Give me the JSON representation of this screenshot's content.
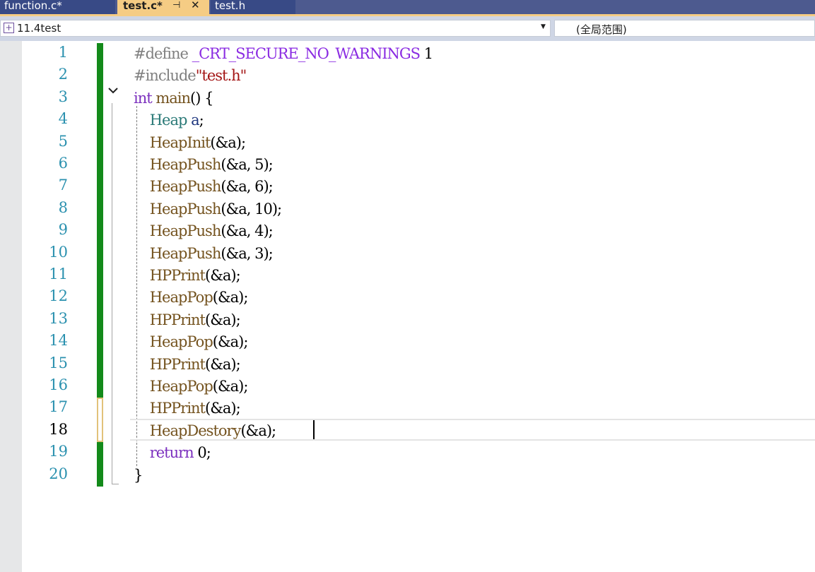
{
  "tabs": [
    {
      "id": "function",
      "label": "function.c*",
      "active": false
    },
    {
      "id": "test_c",
      "label": "test.c*",
      "active": true,
      "pin_icon": "pin-icon",
      "close_icon": "close-icon",
      "close_glyph": "✕",
      "pin_glyph": "⊣"
    },
    {
      "id": "test_h",
      "label": "test.h",
      "active": false
    }
  ],
  "navbar": {
    "project": "11.4test",
    "project_icon": "project-icon",
    "scope": "(全局范围)",
    "dropdown_icon": "chevron-down-icon"
  },
  "editor": {
    "current_line": 18,
    "colors": {
      "keyword": "#7b2fbe",
      "macro": "#8a2be2",
      "string": "#a31515",
      "function": "#74531f",
      "type": "#2b7a78",
      "variable": "#1f377f",
      "number": "#000000",
      "plain": "#000000",
      "preprocessor": "#808080",
      "line_number": "#2b91af",
      "change_saved": "#138a1a"
    },
    "lines": [
      {
        "n": "1",
        "tokens": [
          [
            "#define ",
            "preprocessor"
          ],
          [
            "_CRT_SECURE_NO_WARNINGS",
            "macro"
          ],
          [
            " 1",
            "plain"
          ]
        ]
      },
      {
        "n": "2",
        "tokens": [
          [
            "#include",
            "preprocessor"
          ],
          [
            "\"test.h\"",
            "string"
          ]
        ]
      },
      {
        "n": "3",
        "tokens": [
          [
            "int",
            "keyword"
          ],
          [
            " main",
            "function"
          ],
          [
            "() {",
            "plain"
          ]
        ]
      },
      {
        "n": "4",
        "tokens": [
          [
            "    ",
            "plain"
          ],
          [
            "Heap",
            "type"
          ],
          [
            " a",
            "variable"
          ],
          [
            ";",
            "plain"
          ]
        ]
      },
      {
        "n": "5",
        "tokens": [
          [
            "    ",
            "plain"
          ],
          [
            "HeapInit",
            "function"
          ],
          [
            "(&a);",
            "plain"
          ]
        ]
      },
      {
        "n": "6",
        "tokens": [
          [
            "    ",
            "plain"
          ],
          [
            "HeapPush",
            "function"
          ],
          [
            "(&a, 5);",
            "plain"
          ]
        ]
      },
      {
        "n": "7",
        "tokens": [
          [
            "    ",
            "plain"
          ],
          [
            "HeapPush",
            "function"
          ],
          [
            "(&a, 6);",
            "plain"
          ]
        ]
      },
      {
        "n": "8",
        "tokens": [
          [
            "    ",
            "plain"
          ],
          [
            "HeapPush",
            "function"
          ],
          [
            "(&a, 10);",
            "plain"
          ]
        ]
      },
      {
        "n": "9",
        "tokens": [
          [
            "    ",
            "plain"
          ],
          [
            "HeapPush",
            "function"
          ],
          [
            "(&a, 4);",
            "plain"
          ]
        ]
      },
      {
        "n": "10",
        "tokens": [
          [
            "    ",
            "plain"
          ],
          [
            "HeapPush",
            "function"
          ],
          [
            "(&a, 3);",
            "plain"
          ]
        ]
      },
      {
        "n": "11",
        "tokens": [
          [
            "    ",
            "plain"
          ],
          [
            "HPPrint",
            "function"
          ],
          [
            "(&a);",
            "plain"
          ]
        ]
      },
      {
        "n": "12",
        "tokens": [
          [
            "    ",
            "plain"
          ],
          [
            "HeapPop",
            "function"
          ],
          [
            "(&a);",
            "plain"
          ]
        ]
      },
      {
        "n": "13",
        "tokens": [
          [
            "    ",
            "plain"
          ],
          [
            "HPPrint",
            "function"
          ],
          [
            "(&a);",
            "plain"
          ]
        ]
      },
      {
        "n": "14",
        "tokens": [
          [
            "    ",
            "plain"
          ],
          [
            "HeapPop",
            "function"
          ],
          [
            "(&a);",
            "plain"
          ]
        ]
      },
      {
        "n": "15",
        "tokens": [
          [
            "    ",
            "plain"
          ],
          [
            "HPPrint",
            "function"
          ],
          [
            "(&a);",
            "plain"
          ]
        ]
      },
      {
        "n": "16",
        "tokens": [
          [
            "    ",
            "plain"
          ],
          [
            "HeapPop",
            "function"
          ],
          [
            "(&a);",
            "plain"
          ]
        ]
      },
      {
        "n": "17",
        "tokens": [
          [
            "    ",
            "plain"
          ],
          [
            "HPPrint",
            "function"
          ],
          [
            "(&a);",
            "plain"
          ]
        ]
      },
      {
        "n": "18",
        "tokens": [
          [
            "    ",
            "plain"
          ],
          [
            "HeapDestory",
            "function"
          ],
          [
            "(&a);",
            "plain"
          ]
        ]
      },
      {
        "n": "19",
        "tokens": [
          [
            "    ",
            "plain"
          ],
          [
            "return",
            "keyword"
          ],
          [
            " 0;",
            "plain"
          ]
        ]
      },
      {
        "n": "20",
        "tokens": [
          [
            "}",
            "plain"
          ]
        ]
      }
    ]
  }
}
